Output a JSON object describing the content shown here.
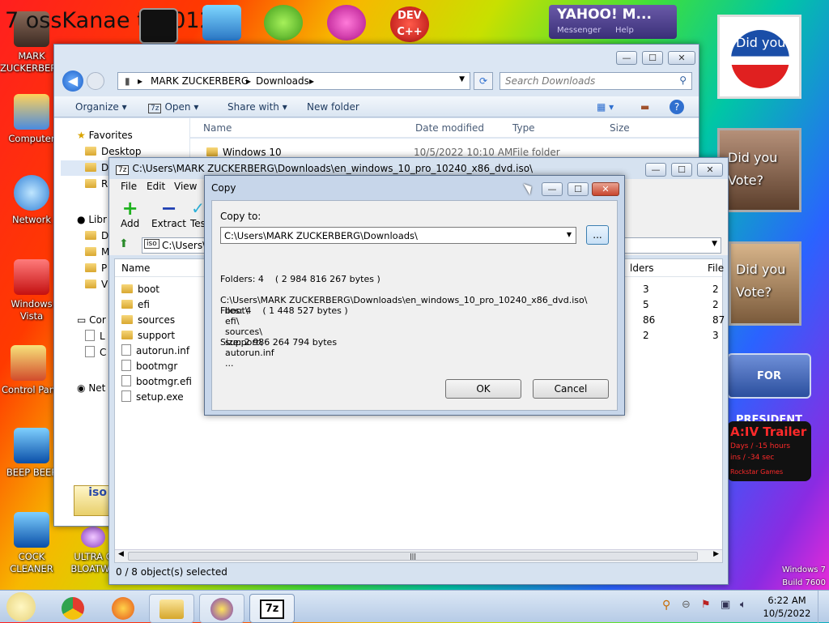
{
  "desktop": {
    "icons": [
      {
        "label": "MARK ZUCKERBERG"
      },
      {
        "label": "Computer"
      },
      {
        "label": "Network"
      },
      {
        "label": "Windows Vista"
      },
      {
        "label": "Control Pan"
      },
      {
        "label": "BEEP BEEP"
      },
      {
        "label": "COCK CLEANER"
      },
      {
        "label": "ULTRA C BLOATWA"
      }
    ],
    "top_text": "7 ossKanae tio 012",
    "top_icons": [
      {
        "label": "DEV C++"
      }
    ],
    "yahoo_gadget": {
      "title": "YAHOO! M...",
      "sub": "Messenger",
      "help": "Help"
    },
    "gadgets": [
      {
        "text": "Did you"
      },
      {
        "text": "Did you Vote?"
      },
      {
        "text": "Did you Vote?"
      },
      {
        "text": "FOR PRESIDENT"
      },
      {
        "text": "A:IV Trailer",
        "line2": "Days / -15 hours",
        "line3": "ins / -34 sec",
        "line4": "Rockstar Games"
      }
    ],
    "watermark": {
      "line1": "Windows 7",
      "line2": "Build 7600"
    }
  },
  "explorer": {
    "address": {
      "crumbs": [
        "MARK ZUCKERBERG",
        "Downloads"
      ]
    },
    "search_placeholder": "Search Downloads",
    "toolbar": {
      "organize": "Organize",
      "open": "Open",
      "share": "Share with",
      "new_folder": "New folder"
    },
    "nav": {
      "favorites": "Favorites",
      "desktop": "Desktop",
      "item_d": "D",
      "item_r": "R",
      "libraries": "Libr",
      "lib_items": [
        "D",
        "M",
        "P",
        "V"
      ],
      "computer": "Cor",
      "comp_items": [
        "L",
        "C"
      ],
      "network": "Net"
    },
    "columns": {
      "name": "Name",
      "date": "Date modified",
      "type": "Type",
      "size": "Size"
    },
    "rows": [
      {
        "name": "Windows 10",
        "date": "10/5/2022 10:10 AM",
        "type": "File folder"
      }
    ]
  },
  "sevenzip": {
    "title": "C:\\Users\\MARK ZUCKERBERG\\Downloads\\en_windows_10_pro_10240_x86_dvd.iso\\",
    "menu": [
      "File",
      "Edit",
      "View"
    ],
    "toolbar": {
      "add": "Add",
      "extract": "Extract",
      "test": "Tes"
    },
    "path": "C:\\Users\\M",
    "columns": {
      "name": "Name",
      "folders": "lders",
      "files": "File"
    },
    "files": [
      {
        "name": "boot",
        "kind": "folder",
        "folders": "3",
        "files": "2"
      },
      {
        "name": "efi",
        "kind": "folder",
        "folders": "5",
        "files": "2"
      },
      {
        "name": "sources",
        "kind": "folder",
        "folders": "86",
        "files": "87"
      },
      {
        "name": "support",
        "kind": "folder",
        "folders": "2",
        "files": "3"
      },
      {
        "name": "autorun.inf",
        "kind": "file",
        "folders": "",
        "files": ""
      },
      {
        "name": "bootmgr",
        "kind": "file",
        "folders": "",
        "files": ""
      },
      {
        "name": "bootmgr.efi",
        "kind": "file",
        "folders": "",
        "files": ""
      },
      {
        "name": "setup.exe",
        "kind": "file",
        "folders": "",
        "files": ""
      }
    ],
    "status": "0 / 8 object(s) selected"
  },
  "copy_dialog": {
    "title": "Copy",
    "copy_to_label": "Copy to:",
    "destination": "C:\\Users\\MARK ZUCKERBERG\\Downloads\\",
    "browse": "...",
    "stats": {
      "folders": "Folders: 4    ( 2 984 816 267 bytes )",
      "files": "Files: 4    ( 1 448 527 bytes )",
      "size": "Size: 2 986 264 794 bytes"
    },
    "source": "C:\\Users\\MARK ZUCKERBERG\\Downloads\\en_windows_10_pro_10240_x86_dvd.iso\\",
    "items": [
      "boot\\",
      "efi\\",
      "sources\\",
      "support\\",
      "autorun.inf",
      "..."
    ],
    "ok": "OK",
    "cancel": "Cancel"
  },
  "taskbar": {
    "time": "6:22 AM",
    "date": "10/5/2022",
    "apps": [
      "chrome",
      "firefox",
      "explorer",
      "yahoo-messenger",
      "7zip"
    ]
  }
}
